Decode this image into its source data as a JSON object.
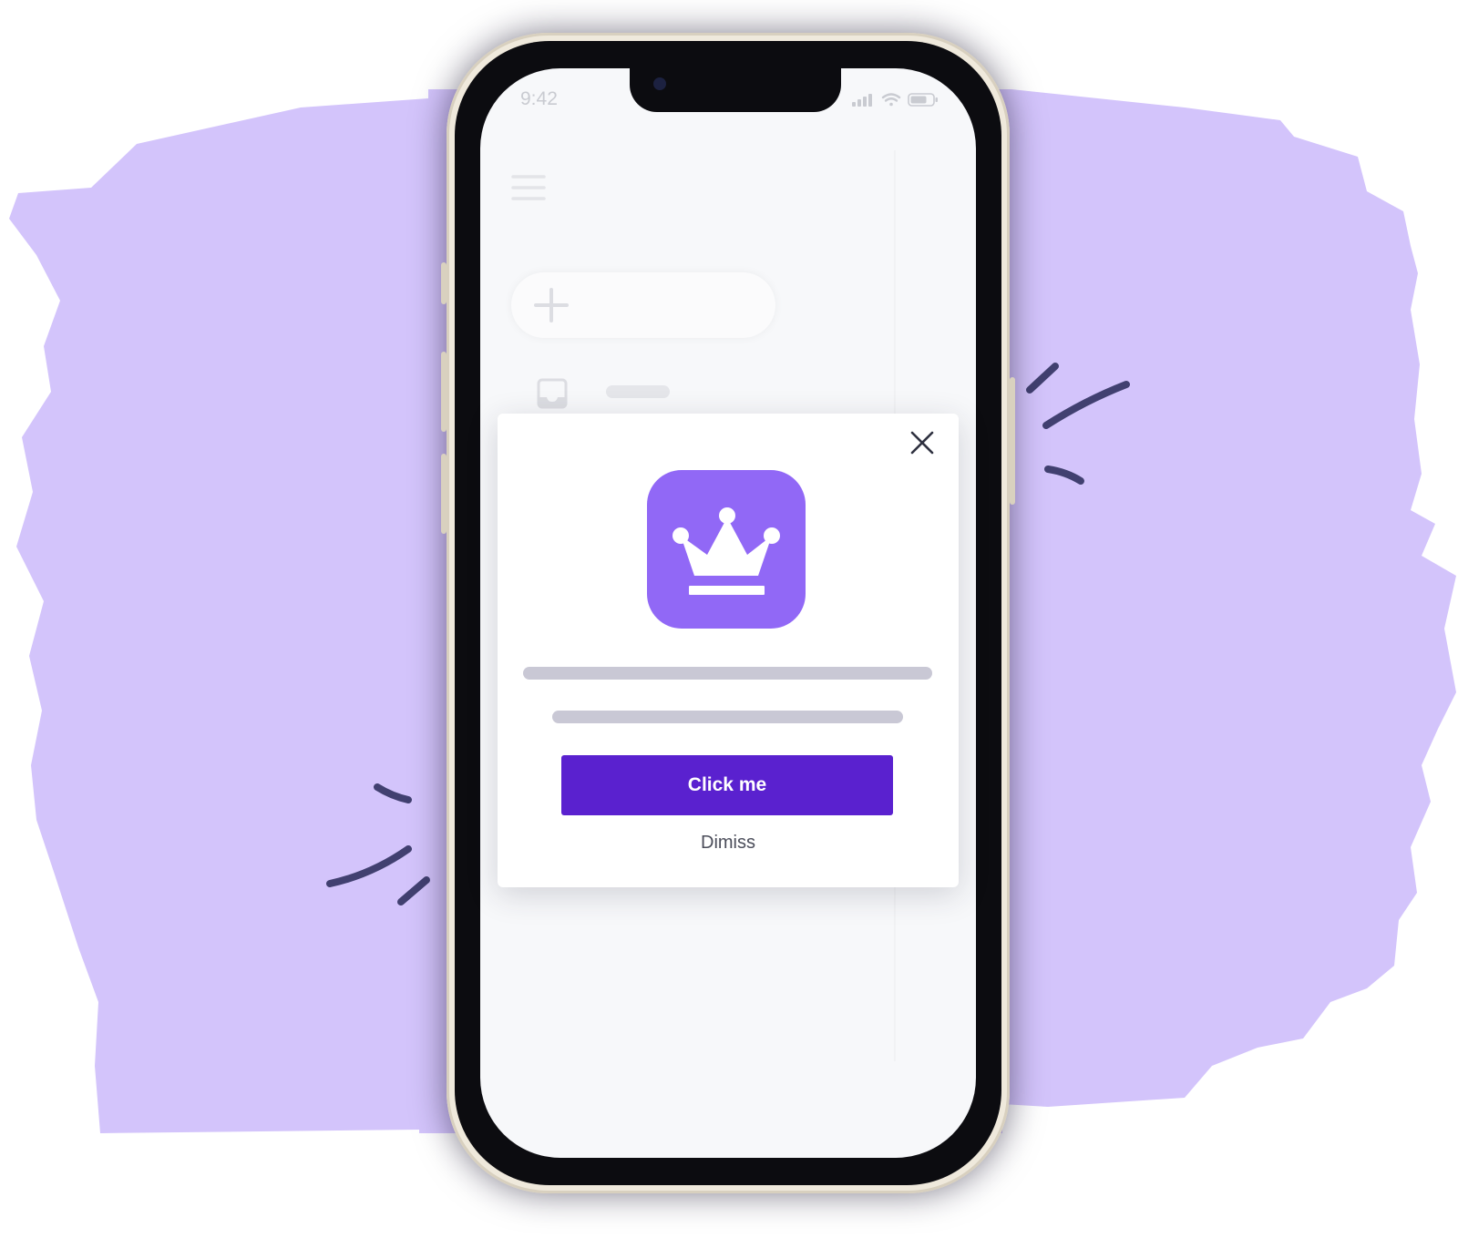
{
  "colors": {
    "backdrop": "#d3c4fb",
    "accent_scribble": "#414070",
    "brand_button": "#5a21cf",
    "app_icon": "#9168f6",
    "skeleton": "#c9c8d5"
  },
  "status_bar": {
    "time": "9:42",
    "icons": [
      "signal-icon",
      "wifi-icon",
      "battery-icon"
    ]
  },
  "background_app": {
    "icons": [
      "menu-icon",
      "plus-icon",
      "inbox-icon"
    ]
  },
  "modal": {
    "icon": "crown-icon",
    "close_icon": "close-icon",
    "primary_button": "Click me",
    "secondary_link": "Dimiss"
  }
}
